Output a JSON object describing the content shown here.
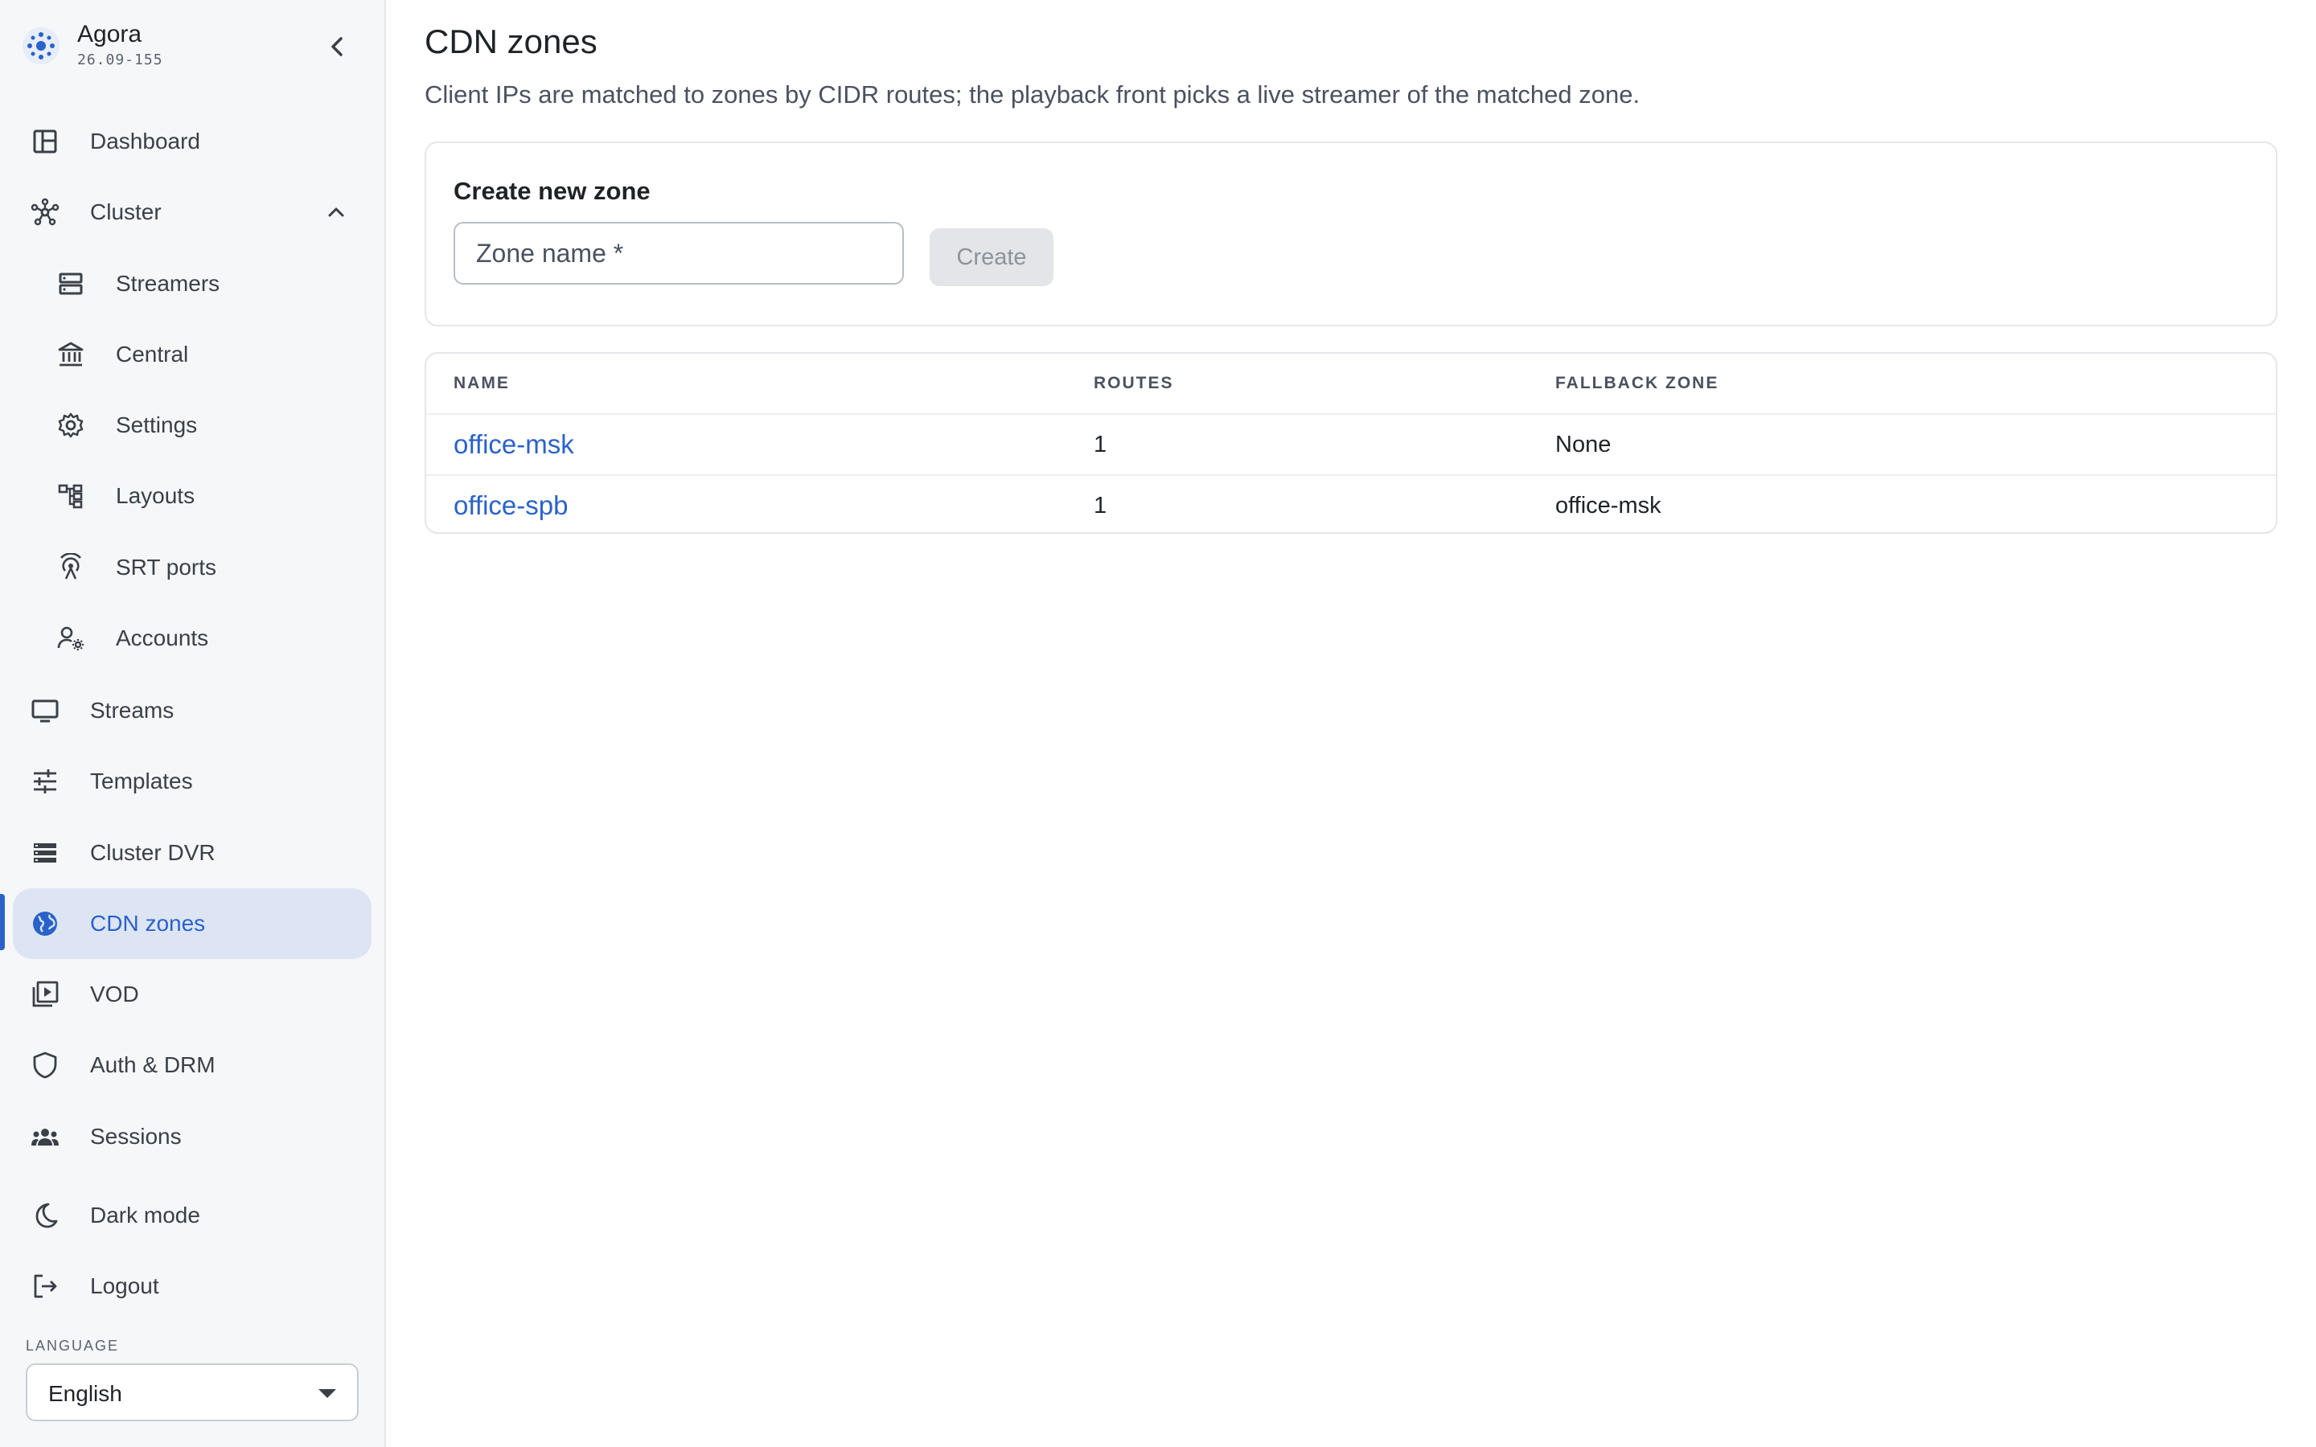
{
  "brand": {
    "name": "Agora",
    "version": "26.09-155"
  },
  "nav": {
    "dashboard": "Dashboard",
    "cluster": "Cluster",
    "streamers": "Streamers",
    "central": "Central",
    "settings": "Settings",
    "layouts": "Layouts",
    "srt_ports": "SRT ports",
    "accounts": "Accounts",
    "streams": "Streams",
    "templates": "Templates",
    "cluster_dvr": "Cluster DVR",
    "cdn_zones": "CDN zones",
    "vod": "VOD",
    "auth_drm": "Auth & DRM",
    "sessions": "Sessions",
    "dark_mode": "Dark mode",
    "logout": "Logout"
  },
  "active_nav": "cdn_zones",
  "language": {
    "label": "LANGUAGE",
    "value": "English"
  },
  "page": {
    "title": "CDN zones",
    "subtitle": "Client IPs are matched to zones by CIDR routes; the playback front picks a live streamer of the matched zone."
  },
  "create_zone": {
    "title": "Create new zone",
    "input_placeholder": "Zone name *",
    "input_value": "",
    "button_label": "Create",
    "button_disabled": true
  },
  "zones_table": {
    "headers": {
      "name": "NAME",
      "routes": "ROUTES",
      "fallback": "FALLBACK ZONE"
    },
    "rows": [
      {
        "name": "office-msk",
        "routes": "1",
        "fallback": "None"
      },
      {
        "name": "office-spb",
        "routes": "1",
        "fallback": "office-msk"
      }
    ]
  },
  "colors": {
    "accent": "#2a62c9",
    "active_bg": "#dde5f5",
    "sidebar_bg": "#f6f7f9",
    "button_disabled_bg": "#e3e5e8"
  }
}
